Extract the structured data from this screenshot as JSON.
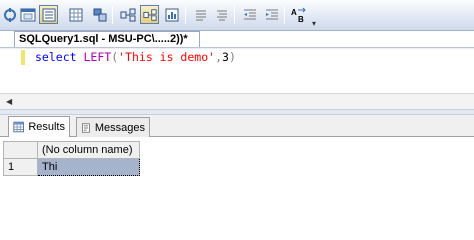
{
  "toolbar": {
    "buttons": [
      {
        "icon": "debug-query-icon"
      },
      {
        "icon": "query-options-icon"
      },
      {
        "icon": "results-to-text-icon"
      },
      {
        "icon": "results-to-grid-icon"
      },
      {
        "icon": "results-to-file-icon"
      },
      {
        "icon": "display-estimated-plan-icon"
      },
      {
        "icon": "include-actual-plan-icon"
      },
      {
        "icon": "client-statistics-icon"
      },
      {
        "icon": "comment-icon"
      },
      {
        "icon": "uncomment-icon"
      },
      {
        "icon": "decrease-indent-icon"
      },
      {
        "icon": "increase-indent-icon"
      },
      {
        "icon": "specify-template-values-icon"
      }
    ],
    "overflow_glyph": "▾"
  },
  "document_tab": {
    "title": "SQLQuery1.sql - MSU-PC\\.....2))*"
  },
  "editor": {
    "tokens": {
      "keyword": "select",
      "space": " ",
      "function": "LEFT",
      "open_paren": "(",
      "string": "'This is demo'",
      "comma": ",",
      "number": "3",
      "close_paren": ")"
    },
    "colors": {
      "keyword": "#0000ff",
      "function": "#b000b0",
      "punctuation": "#808080",
      "string": "#ff0000"
    }
  },
  "scrollbar": {
    "left_arrow": "◀"
  },
  "results_pane": {
    "tabs": [
      {
        "label": "Results",
        "icon": "results-grid-icon",
        "active": true
      },
      {
        "label": "Messages",
        "icon": "messages-icon",
        "active": false
      }
    ],
    "grid": {
      "columns": [
        "(No column name)"
      ],
      "rows": [
        {
          "row_number": "1",
          "values": [
            "Thi"
          ]
        }
      ]
    }
  }
}
